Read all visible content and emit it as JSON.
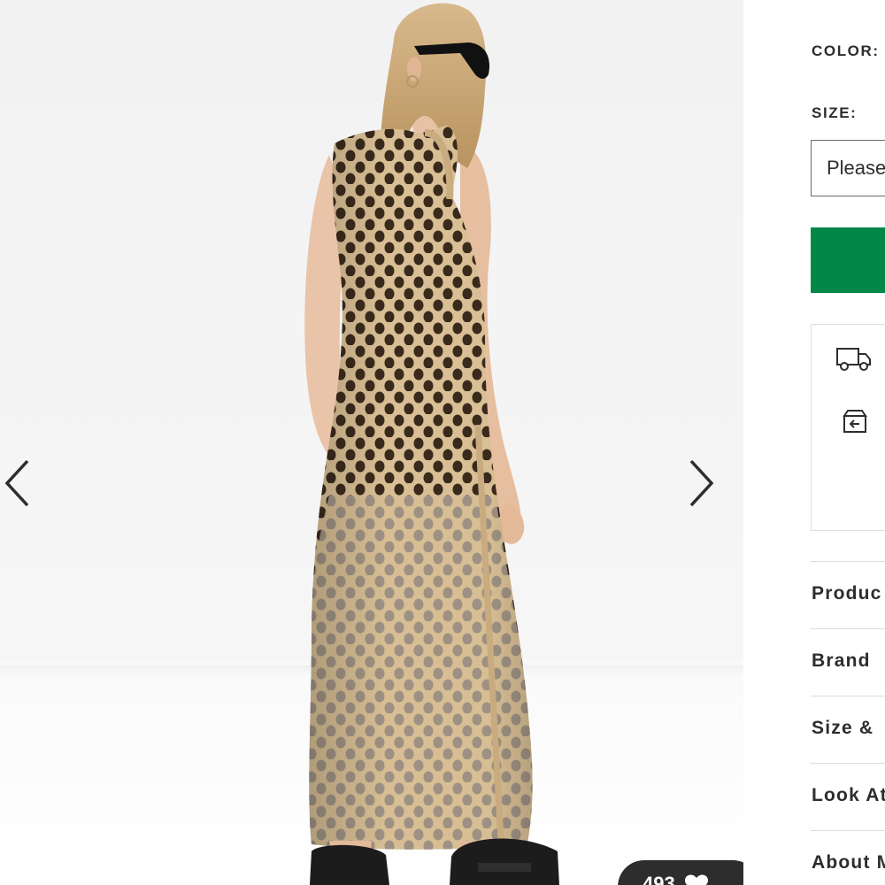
{
  "gallery": {
    "image_alt": "Back view of model wearing a beige open-knit crochet sleeveless maxi dress with black sandals and sunglasses",
    "prev_icon": "chevron-left-icon",
    "next_icon": "chevron-right-icon",
    "like_count": "493",
    "like_icon": "heart-icon"
  },
  "product": {
    "color_label": "COLOR:",
    "size_label": "SIZE:",
    "size_placeholder": "Please",
    "add_to_bag_color": "#018849",
    "delivery_icon": "truck-icon",
    "returns_icon": "return-box-icon"
  },
  "accordion": [
    {
      "label": "Produc"
    },
    {
      "label": "Brand"
    },
    {
      "label": "Size &"
    },
    {
      "label": "Look At"
    },
    {
      "label": "About M"
    }
  ]
}
